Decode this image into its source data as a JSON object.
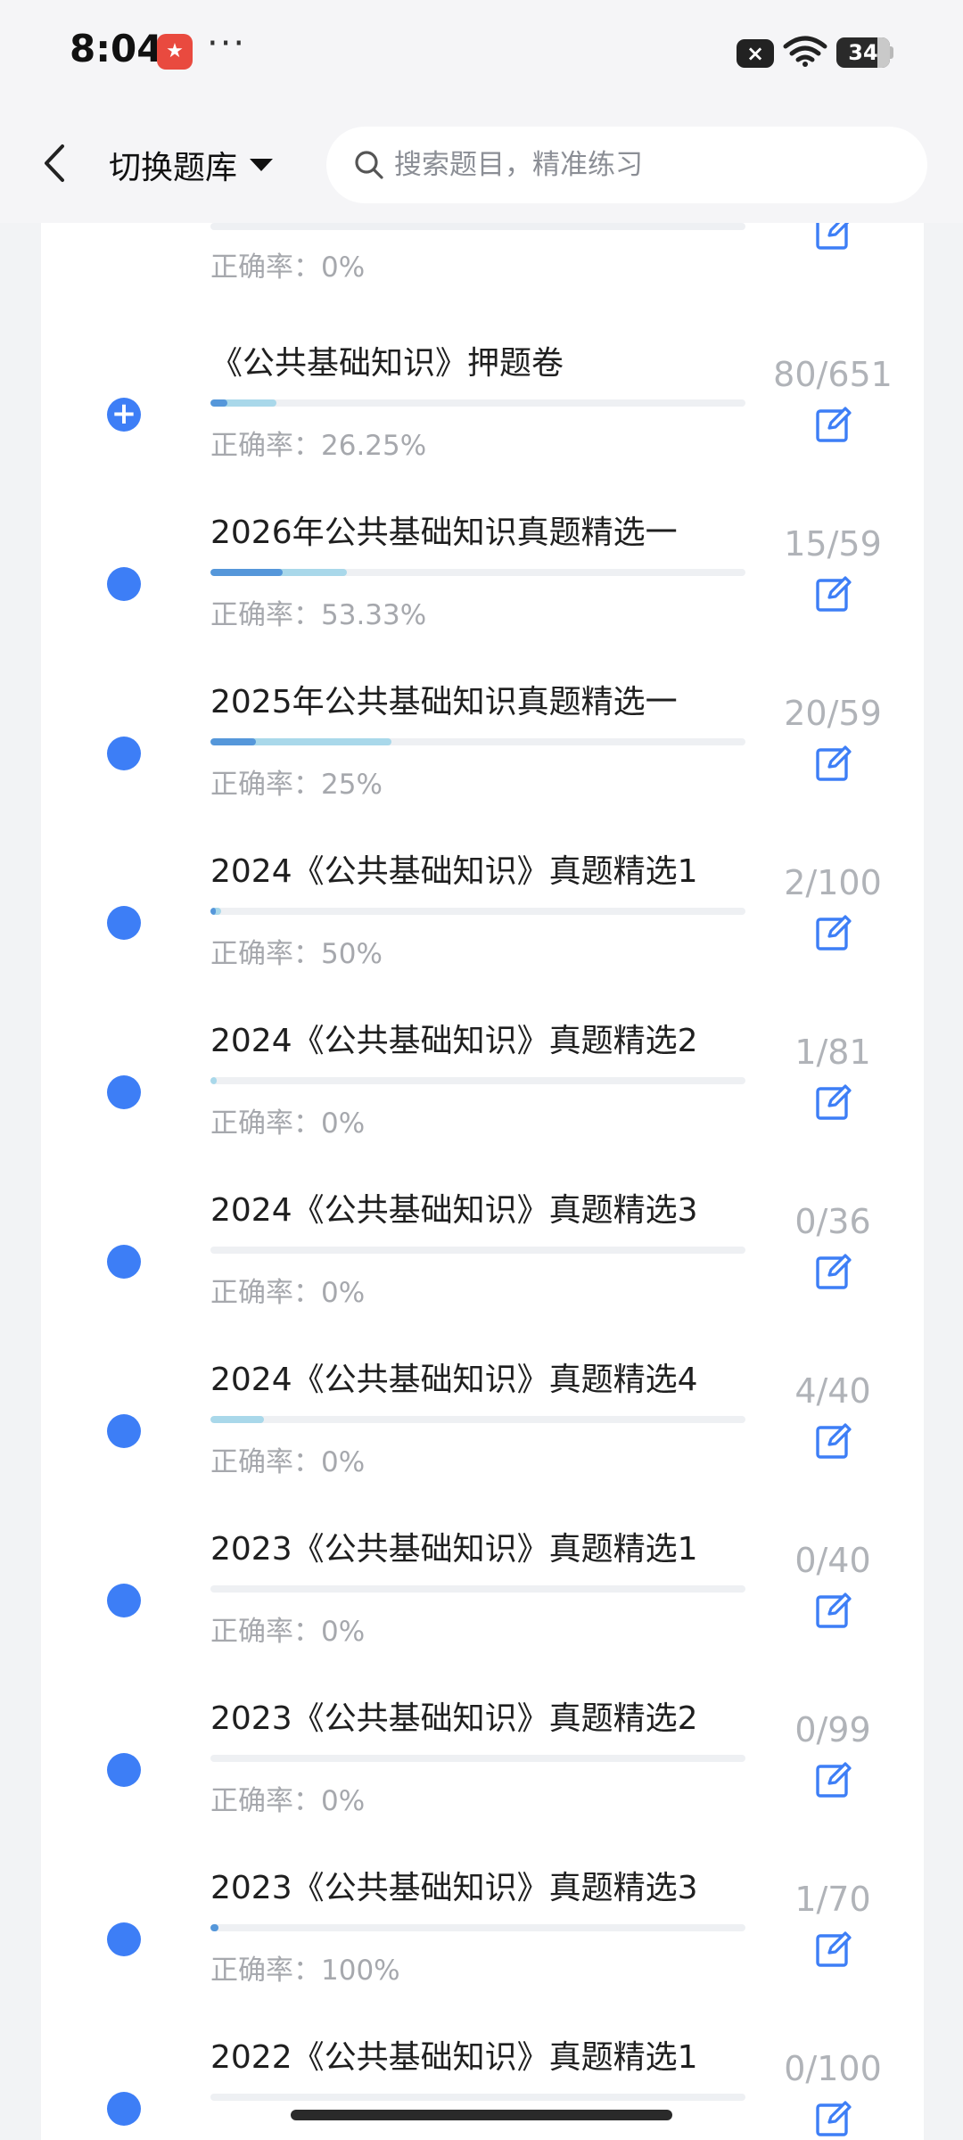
{
  "status_bar": {
    "time": "8:04",
    "dots": "···",
    "close_icon": "×",
    "battery": "34"
  },
  "header": {
    "bank_switch_label": "切换题库",
    "search_placeholder": "搜索题目，精准练习"
  },
  "list": {
    "top_partial_accuracy": "正确率：0%",
    "items": [
      {
        "title": "《公共基础知识》押题卷",
        "accuracy": "正确率：26.25%",
        "count": "80/651",
        "progress_done": 0.1229,
        "progress_correct": 0.0323,
        "marker": "plus"
      },
      {
        "title": "2026年公共基础知识真题精选一",
        "accuracy": "正确率：53.33%",
        "count": "15/59",
        "progress_done": 0.2542,
        "progress_correct": 0.1356,
        "marker": "dot"
      },
      {
        "title": "2025年公共基础知识真题精选一",
        "accuracy": "正确率：25%",
        "count": "20/59",
        "progress_done": 0.339,
        "progress_correct": 0.0847,
        "marker": "dot"
      },
      {
        "title": "2024《公共基础知识》真题精选1",
        "accuracy": "正确率：50%",
        "count": "2/100",
        "progress_done": 0.02,
        "progress_correct": 0.01,
        "marker": "dot"
      },
      {
        "title": "2024《公共基础知识》真题精选2",
        "accuracy": "正确率：0%",
        "count": "1/81",
        "progress_done": 0.0123,
        "progress_correct": 0,
        "marker": "dot"
      },
      {
        "title": "2024《公共基础知识》真题精选3",
        "accuracy": "正确率：0%",
        "count": "0/36",
        "progress_done": 0,
        "progress_correct": 0,
        "marker": "dot"
      },
      {
        "title": "2024《公共基础知识》真题精选4",
        "accuracy": "正确率：0%",
        "count": "4/40",
        "progress_done": 0.1,
        "progress_correct": 0,
        "marker": "dot"
      },
      {
        "title": "2023《公共基础知识》真题精选1",
        "accuracy": "正确率：0%",
        "count": "0/40",
        "progress_done": 0,
        "progress_correct": 0,
        "marker": "dot"
      },
      {
        "title": "2023《公共基础知识》真题精选2",
        "accuracy": "正确率：0%",
        "count": "0/99",
        "progress_done": 0,
        "progress_correct": 0,
        "marker": "dot"
      },
      {
        "title": "2023《公共基础知识》真题精选3",
        "accuracy": "正确率：100%",
        "count": "1/70",
        "progress_done": 0.0143,
        "progress_correct": 0.0143,
        "marker": "dot"
      },
      {
        "title": "2022《公共基础知识》真题精选1",
        "accuracy": "",
        "count": "0/100",
        "progress_done": 0,
        "progress_correct": 0,
        "marker": "dot"
      }
    ]
  },
  "colors": {
    "accent": "#3d7ef6",
    "progress_done": "#a9d8ea",
    "progress_correct": "#5597da",
    "edit_icon": "#3d7ef6"
  }
}
